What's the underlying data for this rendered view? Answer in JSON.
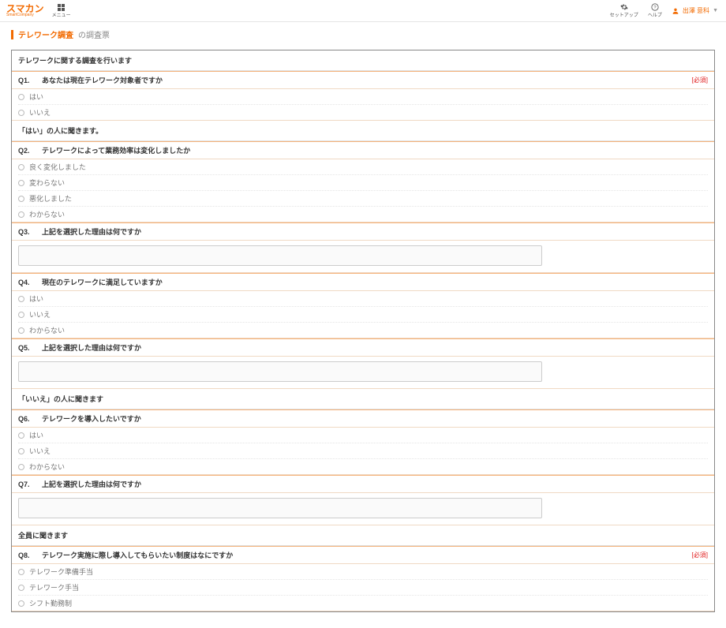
{
  "topbar": {
    "logo_main": "スマカン",
    "logo_sub": "SmartCompany",
    "menu_label": "メニュー",
    "setup_label": "セットアップ",
    "help_label": "ヘルプ",
    "user_name": "出澤 意科"
  },
  "page": {
    "title": "テレワーク調査",
    "suffix": "の調査票"
  },
  "sections": [
    {
      "title": "テレワークに関する調査を行います",
      "questions": [
        {
          "num": "Q1.",
          "text": "あなたは現在テレワーク対象者ですか",
          "required": true,
          "type": "radio",
          "options": [
            "はい",
            "いいえ"
          ]
        }
      ]
    },
    {
      "title": "「はい」の人に聞きます。",
      "questions": [
        {
          "num": "Q2.",
          "text": "テレワークによって業務効率は変化しましたか",
          "required": false,
          "type": "radio",
          "options": [
            "良く変化しました",
            "変わらない",
            "悪化しました",
            "わからない"
          ]
        },
        {
          "num": "Q3.",
          "text": "上記を選択した理由は何ですか",
          "required": false,
          "type": "textarea"
        },
        {
          "num": "Q4.",
          "text": "現在のテレワークに満足していますか",
          "required": false,
          "type": "radio",
          "options": [
            "はい",
            "いいえ",
            "わからない"
          ]
        },
        {
          "num": "Q5.",
          "text": "上記を選択した理由は何ですか",
          "required": false,
          "type": "textarea"
        }
      ]
    },
    {
      "title": "「いいえ」の人に聞きます",
      "questions": [
        {
          "num": "Q6.",
          "text": "テレワークを導入したいですか",
          "required": false,
          "type": "radio",
          "options": [
            "はい",
            "いいえ",
            "わからない"
          ]
        },
        {
          "num": "Q7.",
          "text": "上記を選択した理由は何ですか",
          "required": false,
          "type": "textarea"
        }
      ]
    },
    {
      "title": "全員に聞きます",
      "questions": [
        {
          "num": "Q8.",
          "text": "テレワーク実施に際し導入してもらいたい制度はなにですか",
          "required": true,
          "type": "radio",
          "options": [
            "テレワーク準備手当",
            "テレワーク手当",
            "シフト勤務制"
          ]
        }
      ]
    }
  ],
  "required_label": "[必須]"
}
